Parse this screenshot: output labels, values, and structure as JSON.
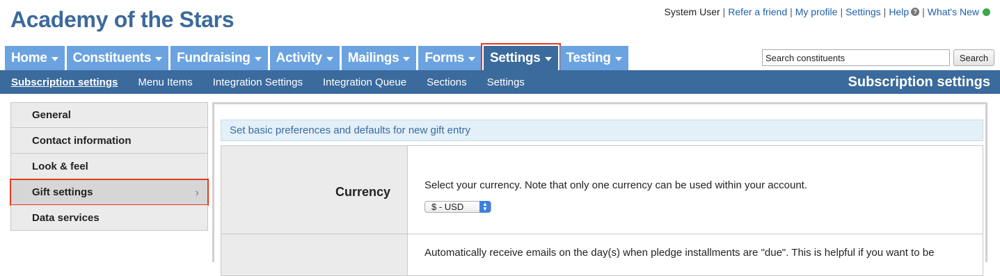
{
  "app": {
    "title": "Academy of the Stars"
  },
  "toplinks": {
    "user": "System User",
    "refer": "Refer a friend",
    "profile": "My profile",
    "settings": "Settings",
    "help": "Help",
    "help_icon": "?",
    "whats_new": "What's New"
  },
  "nav": {
    "tabs": [
      {
        "label": "Home"
      },
      {
        "label": "Constituents"
      },
      {
        "label": "Fundraising"
      },
      {
        "label": "Activity"
      },
      {
        "label": "Mailings"
      },
      {
        "label": "Forms"
      },
      {
        "label": "Settings"
      },
      {
        "label": "Testing"
      }
    ],
    "active_tab": "Settings"
  },
  "search": {
    "value": "Search constituents",
    "button": "Search"
  },
  "subnav": {
    "items": [
      {
        "label": "Subscription settings"
      },
      {
        "label": "Menu Items"
      },
      {
        "label": "Integration Settings"
      },
      {
        "label": "Integration Queue"
      },
      {
        "label": "Sections"
      },
      {
        "label": "Settings"
      }
    ],
    "page_heading": "Subscription settings"
  },
  "sidebar": {
    "items": [
      {
        "label": "General"
      },
      {
        "label": "Contact information"
      },
      {
        "label": "Look & feel"
      },
      {
        "label": "Gift settings",
        "chevron": "›"
      },
      {
        "label": "Data services"
      }
    ]
  },
  "main": {
    "banner": "Set basic preferences and defaults for new gift entry",
    "rows": [
      {
        "label": "Currency",
        "description": "Select your currency. Note that only one currency can be used within your account.",
        "select_value": "$ - USD"
      },
      {
        "label": "",
        "description": "Automatically receive emails on the day(s) when pledge installments are \"due\". This is helpful if you want to be"
      }
    ]
  },
  "colors": {
    "brand": "#3b6a9c",
    "tab": "#6ba3e0",
    "highlight": "#e23b1e",
    "status": "#3aa84d"
  },
  "icons": {
    "help": "help-icon",
    "status": "status-dot-icon",
    "caret": "caret-down-icon",
    "chevron": "chevron-right-icon",
    "select": "select-arrows-icon"
  }
}
